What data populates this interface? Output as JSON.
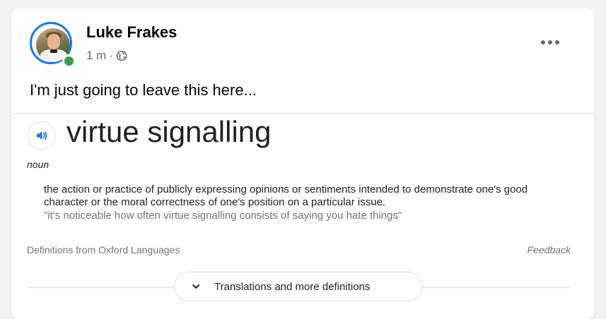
{
  "post": {
    "author": "Luke Frakes",
    "time": "1 m",
    "separator": "·",
    "privacy_icon": "globe-icon",
    "text": "I'm just going to leave this here..."
  },
  "definition_card": {
    "word": "virtue signalling",
    "part_of_speech": "noun",
    "definition": "the action or practice of publicly expressing opinions or sentiments intended to demonstrate one's good character or the moral correctness of one's position on a particular issue.",
    "example": "\"it's noticeable how often virtue signalling consists of saying you hate things\"",
    "source": "Definitions from Oxford Languages",
    "feedback": "Feedback",
    "more_label": "Translations and more definitions"
  },
  "colors": {
    "accent": "#1877f2",
    "online": "#31a24c",
    "speaker": "#1a73e8"
  }
}
